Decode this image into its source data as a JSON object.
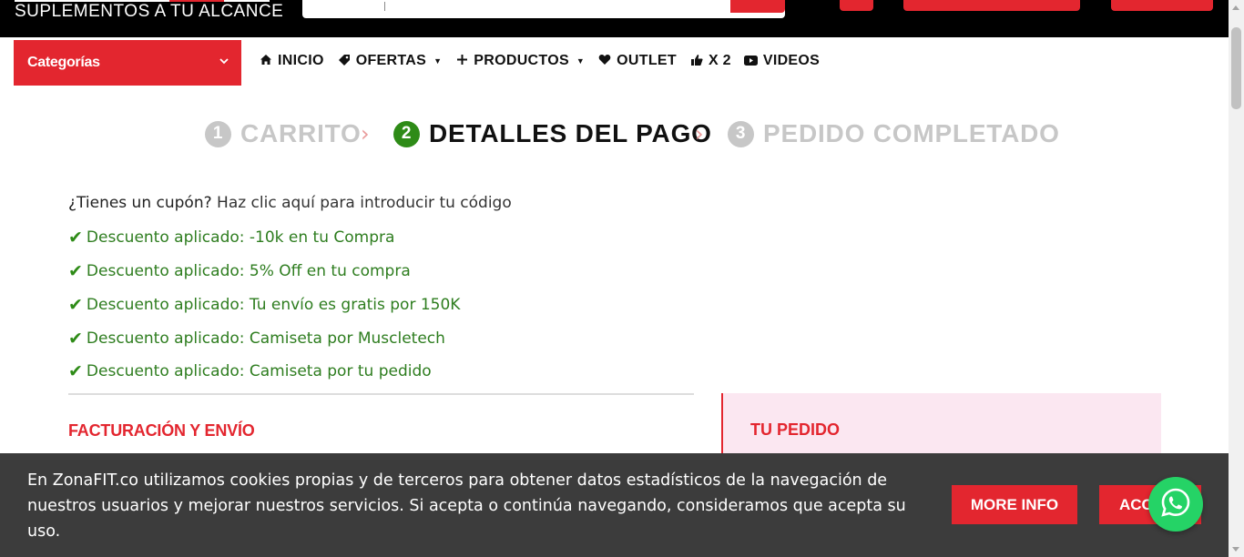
{
  "header": {
    "tagline": "SUPLEMENTOS A TU ALCANCE"
  },
  "nav": {
    "categories_label": "Categorías",
    "items": [
      {
        "label": "INICIO",
        "icon": "home-icon"
      },
      {
        "label": "OFERTAS",
        "icon": "tag-icon",
        "dropdown": true
      },
      {
        "label": "PRODUCTOS",
        "icon": "plus-icon",
        "dropdown": true
      },
      {
        "label": "OUTLET",
        "icon": "heart-icon"
      },
      {
        "label": "X 2",
        "icon": "thumbs-up-icon"
      },
      {
        "label": "VIDEOS",
        "icon": "youtube-icon"
      }
    ]
  },
  "steps": [
    {
      "num": "1",
      "label": "CARRITO",
      "state": "inactive"
    },
    {
      "num": "2",
      "label": "DETALLES DEL PAGO",
      "state": "active"
    },
    {
      "num": "3",
      "label": "PEDIDO COMPLETADO",
      "state": "inactive"
    }
  ],
  "coupon": {
    "question": "¿Tienes un cupón?",
    "link": "Haz clic aquí para introducir tu código"
  },
  "notices": [
    "Descuento aplicado: -10k en tu Compra",
    "Descuento aplicado: 5% Off en tu compra",
    "Descuento aplicado: Tu envío es gratis por 150K",
    "Descuento aplicado: Camiseta por Muscletech",
    "Descuento aplicado: Camiseta por tu pedido"
  ],
  "billing": {
    "title": "FACTURACIÓN Y ENVÍO"
  },
  "order": {
    "title": "TU PEDIDO"
  },
  "cookie": {
    "text": "En ZonaFIT.co utilizamos cookies propias y de terceros para obtener datos estadísticos de la navegación de nuestros usuarios y mejorar nuestros servicios. Si acepta o continúa navegando, consideramos que acepta su uso.",
    "more_info": "MORE INFO",
    "accept": "ACCEPT"
  },
  "colors": {
    "brand_red": "#e3262f",
    "success_green": "#2e8b17",
    "whatsapp_green": "#25d366"
  }
}
